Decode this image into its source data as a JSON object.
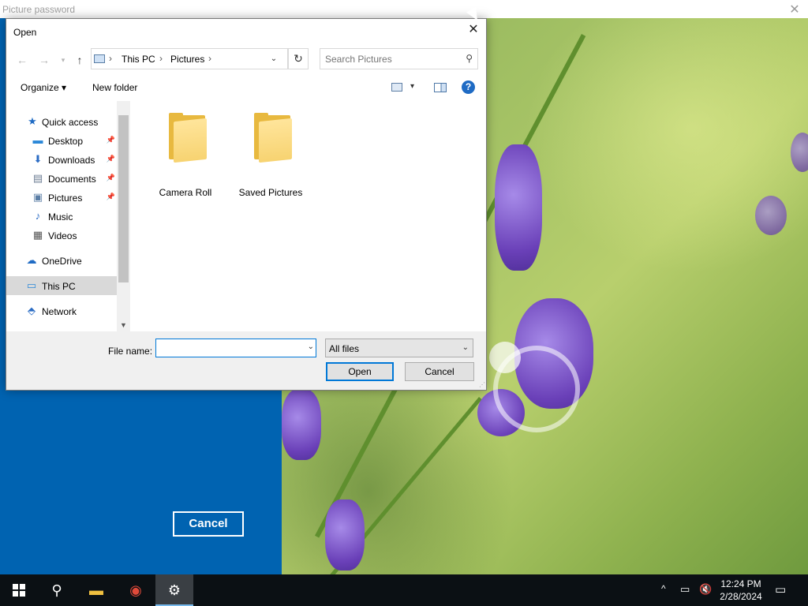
{
  "background_window": {
    "title": "Picture password",
    "close_glyph": "✕",
    "cancel_label": "Cancel"
  },
  "dialog": {
    "title": "Open",
    "close_glyph": "✕",
    "nav": {
      "back_glyph": "←",
      "forward_glyph": "→",
      "recent_glyph": "▾",
      "up_glyph": "↑"
    },
    "address": {
      "crumbs": [
        "This PC",
        "Pictures"
      ],
      "separator": "›",
      "dropdown_glyph": "⌄"
    },
    "refresh_glyph": "↻",
    "search": {
      "placeholder": "Search Pictures",
      "icon_glyph": "⚲"
    },
    "toolbar": {
      "organize_label": "Organize ▾",
      "new_folder_label": "New folder",
      "view_drop_glyph": "▾",
      "help_glyph": "?"
    },
    "nav_pane": {
      "items": [
        {
          "label": "Quick access",
          "icon": "star-icon",
          "glyph": "★",
          "color": "#1f6bc4",
          "pinned": false
        },
        {
          "label": "Desktop",
          "icon": "desktop-icon",
          "glyph": "▬",
          "color": "#2b88d8",
          "pinned": true
        },
        {
          "label": "Downloads",
          "icon": "download-icon",
          "glyph": "⬇",
          "color": "#2b6cc4",
          "pinned": true
        },
        {
          "label": "Documents",
          "icon": "document-icon",
          "glyph": "▤",
          "color": "#6b7c93",
          "pinned": true
        },
        {
          "label": "Pictures",
          "icon": "pictures-icon",
          "glyph": "▣",
          "color": "#5b7ea6",
          "pinned": true
        },
        {
          "label": "Music",
          "icon": "music-icon",
          "glyph": "♪",
          "color": "#2b6cc4",
          "pinned": false
        },
        {
          "label": "Videos",
          "icon": "video-icon",
          "glyph": "▦",
          "color": "#555555",
          "pinned": false
        },
        {
          "label": "OneDrive",
          "icon": "cloud-icon",
          "glyph": "☁",
          "color": "#1f6bc4",
          "pinned": false
        },
        {
          "label": "This PC",
          "icon": "computer-icon",
          "glyph": "▭",
          "color": "#2b88d8",
          "pinned": false,
          "selected": true
        },
        {
          "label": "Network",
          "icon": "network-icon",
          "glyph": "⬘",
          "color": "#2b6cc4",
          "pinned": false
        }
      ],
      "pin_glyph": "📌",
      "scroll_down_glyph": "▼"
    },
    "folders": [
      {
        "label": "Camera Roll"
      },
      {
        "label": "Saved Pictures"
      }
    ],
    "file_name": {
      "label": "File name:",
      "value": "",
      "dropdown_glyph": "⌄"
    },
    "filter": {
      "selected": "All files",
      "dropdown_glyph": "⌄"
    },
    "open_label": "Open",
    "cancel_label": "Cancel",
    "grip_glyph": "⋰"
  },
  "taskbar": {
    "apps": [
      {
        "name": "search",
        "glyph": "⚲"
      },
      {
        "name": "file-explorer",
        "glyph": "▬"
      },
      {
        "name": "chrome",
        "glyph": "◉"
      },
      {
        "name": "settings",
        "glyph": "⚙",
        "active": true
      }
    ],
    "tray": {
      "chevron_glyph": "^",
      "network_glyph": "▭",
      "volume_glyph": "🔇"
    },
    "time": "12:24 PM",
    "date": "2/28/2024",
    "notification_glyph": "▭"
  },
  "colors": {
    "accent": "#0078d7",
    "lock_blue": "#0063b1",
    "folder_yellow": "#f7d371",
    "taskbar": "#0b1014"
  }
}
